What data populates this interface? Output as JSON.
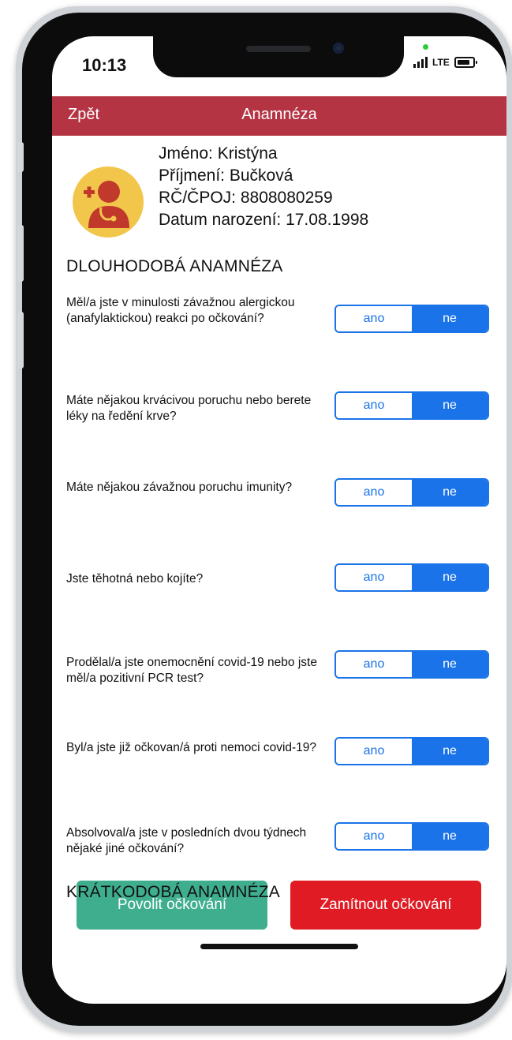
{
  "status_bar": {
    "time": "10:13",
    "network": "LTE"
  },
  "navbar": {
    "back_label": "Zpět",
    "title": "Anamnéza"
  },
  "patient": {
    "name": "Jméno: Kristýna",
    "surname": "Příjmení: Bučková",
    "id": "RČ/ČPOJ: 8808080259",
    "birthdate": "Datum narození: 17.08.1998"
  },
  "sections": {
    "long_term": "DLOUHODOBÁ ANAMNÉZA",
    "short_term": "KRÁTKODOBÁ ANAMNÉZA"
  },
  "questions": [
    {
      "text": "Měl/a jste v minulosti závažnou alergickou (anafylaktickou) reakci po očkování?",
      "yes": "ano",
      "no": "ne",
      "selected": "ne"
    },
    {
      "text": "Máte nějakou krvácivou poruchu nebo berete léky na ředění krve?",
      "yes": "ano",
      "no": "ne",
      "selected": "ne"
    },
    {
      "text": "Máte nějakou závažnou poruchu imunity?",
      "yes": "ano",
      "no": "ne",
      "selected": "ne"
    },
    {
      "text": "Jste těhotná nebo kojíte?",
      "yes": "ano",
      "no": "ne",
      "selected": "ne"
    },
    {
      "text": "Prodělal/a jste onemocnění covid-19 nebo jste měl/a pozitivní PCR test?",
      "yes": "ano",
      "no": "ne",
      "selected": "ne"
    },
    {
      "text": "Byl/a jste již očkovan/á proti nemoci covid-19?",
      "yes": "ano",
      "no": "ne",
      "selected": "ne"
    },
    {
      "text": "Absolvoval/a jste v posledních dvou týdnech nějaké jiné očkování?",
      "yes": "ano",
      "no": "ne",
      "selected": "ne"
    }
  ],
  "actions": {
    "allow": "Povolit očkování",
    "deny": "Zamítnout očkování"
  },
  "colors": {
    "header": "#b53444",
    "toggle_blue": "#1a73e8",
    "allow": "#3fae8e",
    "deny": "#e01b24",
    "avatar": "#f2c64b"
  },
  "icons": {
    "avatar": "doctor-icon"
  }
}
